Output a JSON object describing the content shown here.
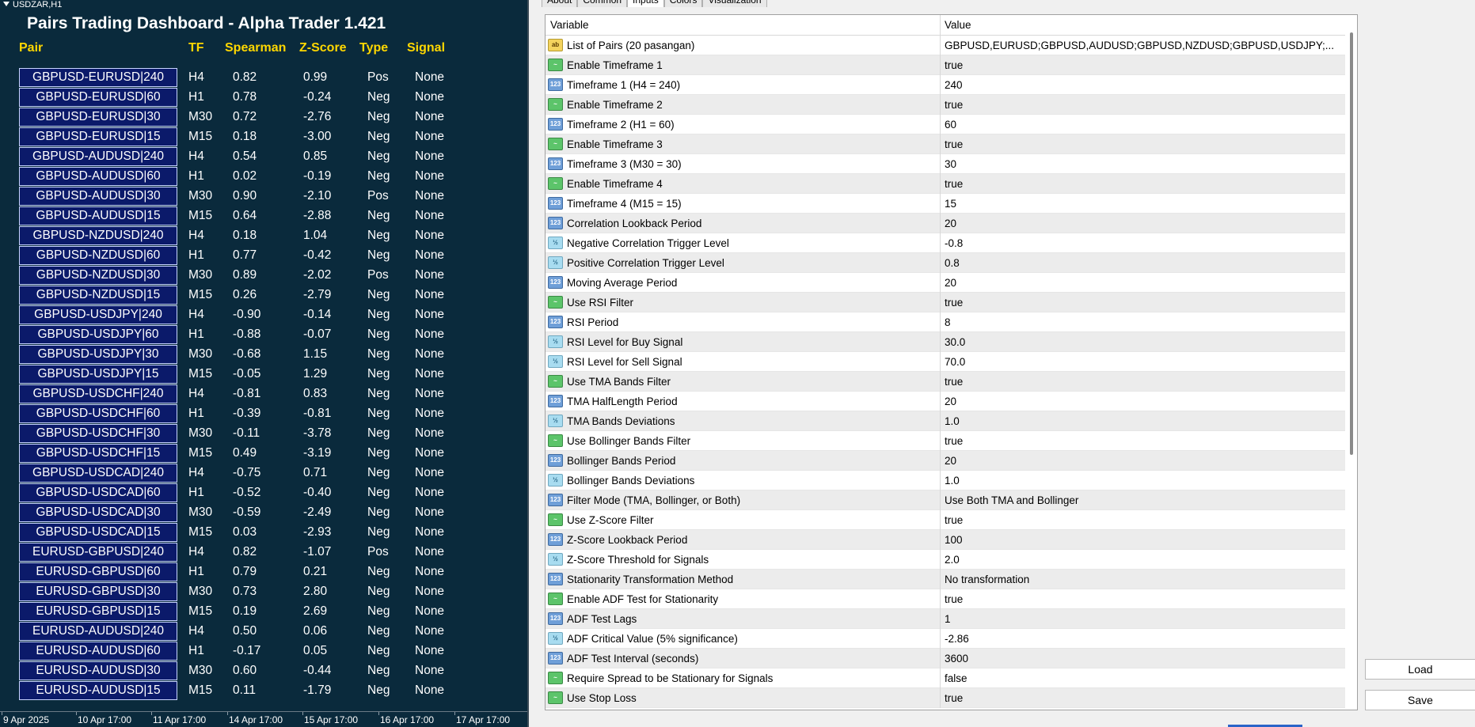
{
  "chart": {
    "symbol": "USDZAR,H1",
    "title": "Pairs Trading Dashboard - Alpha Trader 1.421",
    "headers": {
      "pair": "Pair",
      "tf": "TF",
      "spearman": "Spearman",
      "zscore": "Z-Score",
      "type": "Type",
      "signal": "Signal"
    },
    "rows": [
      {
        "pair": "GBPUSD-EURUSD|240",
        "tf": "H4",
        "spearman": "0.82",
        "zscore": "0.99",
        "type": "Pos",
        "signal": "None"
      },
      {
        "pair": "GBPUSD-EURUSD|60",
        "tf": "H1",
        "spearman": "0.78",
        "zscore": "-0.24",
        "type": "Neg",
        "signal": "None"
      },
      {
        "pair": "GBPUSD-EURUSD|30",
        "tf": "M30",
        "spearman": "0.72",
        "zscore": "-2.76",
        "type": "Neg",
        "signal": "None"
      },
      {
        "pair": "GBPUSD-EURUSD|15",
        "tf": "M15",
        "spearman": "0.18",
        "zscore": "-3.00",
        "type": "Neg",
        "signal": "None"
      },
      {
        "pair": "GBPUSD-AUDUSD|240",
        "tf": "H4",
        "spearman": "0.54",
        "zscore": "0.85",
        "type": "Neg",
        "signal": "None"
      },
      {
        "pair": "GBPUSD-AUDUSD|60",
        "tf": "H1",
        "spearman": "0.02",
        "zscore": "-0.19",
        "type": "Neg",
        "signal": "None"
      },
      {
        "pair": "GBPUSD-AUDUSD|30",
        "tf": "M30",
        "spearman": "0.90",
        "zscore": "-2.10",
        "type": "Pos",
        "signal": "None"
      },
      {
        "pair": "GBPUSD-AUDUSD|15",
        "tf": "M15",
        "spearman": "0.64",
        "zscore": "-2.88",
        "type": "Neg",
        "signal": "None"
      },
      {
        "pair": "GBPUSD-NZDUSD|240",
        "tf": "H4",
        "spearman": "0.18",
        "zscore": "1.04",
        "type": "Neg",
        "signal": "None"
      },
      {
        "pair": "GBPUSD-NZDUSD|60",
        "tf": "H1",
        "spearman": "0.77",
        "zscore": "-0.42",
        "type": "Neg",
        "signal": "None"
      },
      {
        "pair": "GBPUSD-NZDUSD|30",
        "tf": "M30",
        "spearman": "0.89",
        "zscore": "-2.02",
        "type": "Pos",
        "signal": "None"
      },
      {
        "pair": "GBPUSD-NZDUSD|15",
        "tf": "M15",
        "spearman": "0.26",
        "zscore": "-2.79",
        "type": "Neg",
        "signal": "None"
      },
      {
        "pair": "GBPUSD-USDJPY|240",
        "tf": "H4",
        "spearman": "-0.90",
        "zscore": "-0.14",
        "type": "Neg",
        "signal": "None"
      },
      {
        "pair": "GBPUSD-USDJPY|60",
        "tf": "H1",
        "spearman": "-0.88",
        "zscore": "-0.07",
        "type": "Neg",
        "signal": "None"
      },
      {
        "pair": "GBPUSD-USDJPY|30",
        "tf": "M30",
        "spearman": "-0.68",
        "zscore": "1.15",
        "type": "Neg",
        "signal": "None"
      },
      {
        "pair": "GBPUSD-USDJPY|15",
        "tf": "M15",
        "spearman": "-0.05",
        "zscore": "1.29",
        "type": "Neg",
        "signal": "None"
      },
      {
        "pair": "GBPUSD-USDCHF|240",
        "tf": "H4",
        "spearman": "-0.81",
        "zscore": "0.83",
        "type": "Neg",
        "signal": "None"
      },
      {
        "pair": "GBPUSD-USDCHF|60",
        "tf": "H1",
        "spearman": "-0.39",
        "zscore": "-0.81",
        "type": "Neg",
        "signal": "None"
      },
      {
        "pair": "GBPUSD-USDCHF|30",
        "tf": "M30",
        "spearman": "-0.11",
        "zscore": "-3.78",
        "type": "Neg",
        "signal": "None"
      },
      {
        "pair": "GBPUSD-USDCHF|15",
        "tf": "M15",
        "spearman": "0.49",
        "zscore": "-3.19",
        "type": "Neg",
        "signal": "None"
      },
      {
        "pair": "GBPUSD-USDCAD|240",
        "tf": "H4",
        "spearman": "-0.75",
        "zscore": "0.71",
        "type": "Neg",
        "signal": "None"
      },
      {
        "pair": "GBPUSD-USDCAD|60",
        "tf": "H1",
        "spearman": "-0.52",
        "zscore": "-0.40",
        "type": "Neg",
        "signal": "None"
      },
      {
        "pair": "GBPUSD-USDCAD|30",
        "tf": "M30",
        "spearman": "-0.59",
        "zscore": "-2.49",
        "type": "Neg",
        "signal": "None"
      },
      {
        "pair": "GBPUSD-USDCAD|15",
        "tf": "M15",
        "spearman": "0.03",
        "zscore": "-2.93",
        "type": "Neg",
        "signal": "None"
      },
      {
        "pair": "EURUSD-GBPUSD|240",
        "tf": "H4",
        "spearman": "0.82",
        "zscore": "-1.07",
        "type": "Pos",
        "signal": "None"
      },
      {
        "pair": "EURUSD-GBPUSD|60",
        "tf": "H1",
        "spearman": "0.79",
        "zscore": "0.21",
        "type": "Neg",
        "signal": "None"
      },
      {
        "pair": "EURUSD-GBPUSD|30",
        "tf": "M30",
        "spearman": "0.73",
        "zscore": "2.80",
        "type": "Neg",
        "signal": "None"
      },
      {
        "pair": "EURUSD-GBPUSD|15",
        "tf": "M15",
        "spearman": "0.19",
        "zscore": "2.69",
        "type": "Neg",
        "signal": "None"
      },
      {
        "pair": "EURUSD-AUDUSD|240",
        "tf": "H4",
        "spearman": "0.50",
        "zscore": "0.06",
        "type": "Neg",
        "signal": "None"
      },
      {
        "pair": "EURUSD-AUDUSD|60",
        "tf": "H1",
        "spearman": "-0.17",
        "zscore": "0.05",
        "type": "Neg",
        "signal": "None"
      },
      {
        "pair": "EURUSD-AUDUSD|30",
        "tf": "M30",
        "spearman": "0.60",
        "zscore": "-0.44",
        "type": "Neg",
        "signal": "None"
      },
      {
        "pair": "EURUSD-AUDUSD|15",
        "tf": "M15",
        "spearman": "0.11",
        "zscore": "-1.79",
        "type": "Neg",
        "signal": "None"
      }
    ],
    "time_ticks": [
      "9 Apr 2025",
      "10 Apr 17:00",
      "11 Apr 17:00",
      "14 Apr 17:00",
      "15 Apr 17:00",
      "16 Apr 17:00",
      "17 Apr 17:00"
    ],
    "colors": {
      "background": "#0a2a3c",
      "header": "#ffd700",
      "pair_box": "#0b1a6a",
      "text": "#ffffff"
    }
  },
  "dialog": {
    "tabs": [
      "About",
      "Common",
      "Inputs",
      "Colors",
      "Visualization"
    ],
    "active_tab": "Inputs",
    "columns": {
      "variable": "Variable",
      "value": "Value"
    },
    "params": [
      {
        "icon": "ab",
        "name": "List of Pairs (20 pasangan)",
        "value": "GBPUSD,EURUSD;GBPUSD,AUDUSD;GBPUSD,NZDUSD;GBPUSD,USDJPY;..."
      },
      {
        "icon": "bool",
        "name": "Enable Timeframe 1",
        "value": "true"
      },
      {
        "icon": "int",
        "name": "Timeframe 1 (H4 = 240)",
        "value": "240"
      },
      {
        "icon": "bool",
        "name": "Enable Timeframe 2",
        "value": "true"
      },
      {
        "icon": "int",
        "name": "Timeframe 2 (H1 = 60)",
        "value": "60"
      },
      {
        "icon": "bool",
        "name": "Enable Timeframe 3",
        "value": "true"
      },
      {
        "icon": "int",
        "name": "Timeframe 3 (M30 = 30)",
        "value": "30"
      },
      {
        "icon": "bool",
        "name": "Enable Timeframe 4",
        "value": "true"
      },
      {
        "icon": "int",
        "name": "Timeframe 4 (M15 = 15)",
        "value": "15"
      },
      {
        "icon": "int",
        "name": "Correlation Lookback Period",
        "value": "20"
      },
      {
        "icon": "dbl",
        "name": "Negative Correlation Trigger Level",
        "value": "-0.8"
      },
      {
        "icon": "dbl",
        "name": "Positive Correlation Trigger Level",
        "value": "0.8"
      },
      {
        "icon": "int",
        "name": "Moving Average Period",
        "value": "20"
      },
      {
        "icon": "bool",
        "name": "Use RSI Filter",
        "value": "true"
      },
      {
        "icon": "int",
        "name": "RSI Period",
        "value": "8"
      },
      {
        "icon": "dbl",
        "name": "RSI Level for Buy Signal",
        "value": "30.0"
      },
      {
        "icon": "dbl",
        "name": "RSI Level for Sell Signal",
        "value": "70.0"
      },
      {
        "icon": "bool",
        "name": "Use TMA Bands Filter",
        "value": "true"
      },
      {
        "icon": "int",
        "name": "TMA HalfLength Period",
        "value": "20"
      },
      {
        "icon": "dbl",
        "name": "TMA Bands Deviations",
        "value": "1.0"
      },
      {
        "icon": "bool",
        "name": "Use Bollinger Bands Filter",
        "value": "true"
      },
      {
        "icon": "int",
        "name": "Bollinger Bands Period",
        "value": "20"
      },
      {
        "icon": "dbl",
        "name": "Bollinger Bands Deviations",
        "value": "1.0"
      },
      {
        "icon": "int",
        "name": "Filter Mode (TMA, Bollinger, or Both)",
        "value": "Use Both TMA and Bollinger"
      },
      {
        "icon": "bool",
        "name": "Use Z-Score Filter",
        "value": "true"
      },
      {
        "icon": "int",
        "name": "Z-Score Lookback Period",
        "value": "100"
      },
      {
        "icon": "dbl",
        "name": "Z-Score Threshold for Signals",
        "value": "2.0"
      },
      {
        "icon": "int",
        "name": "Stationarity Transformation Method",
        "value": "No transformation"
      },
      {
        "icon": "bool",
        "name": "Enable ADF Test for Stationarity",
        "value": "true"
      },
      {
        "icon": "int",
        "name": "ADF Test Lags",
        "value": "1"
      },
      {
        "icon": "dbl",
        "name": "ADF Critical Value (5% significance)",
        "value": "-2.86"
      },
      {
        "icon": "int",
        "name": "ADF Test Interval (seconds)",
        "value": "3600"
      },
      {
        "icon": "bool",
        "name": "Require Spread to be Stationary for Signals",
        "value": "false"
      },
      {
        "icon": "bool",
        "name": "Use Stop Loss",
        "value": "true"
      }
    ],
    "icon_labels": {
      "ab": "ab",
      "bool": "~",
      "int": "123",
      "dbl": "½"
    },
    "buttons": {
      "load": "Load",
      "save": "Save"
    }
  }
}
